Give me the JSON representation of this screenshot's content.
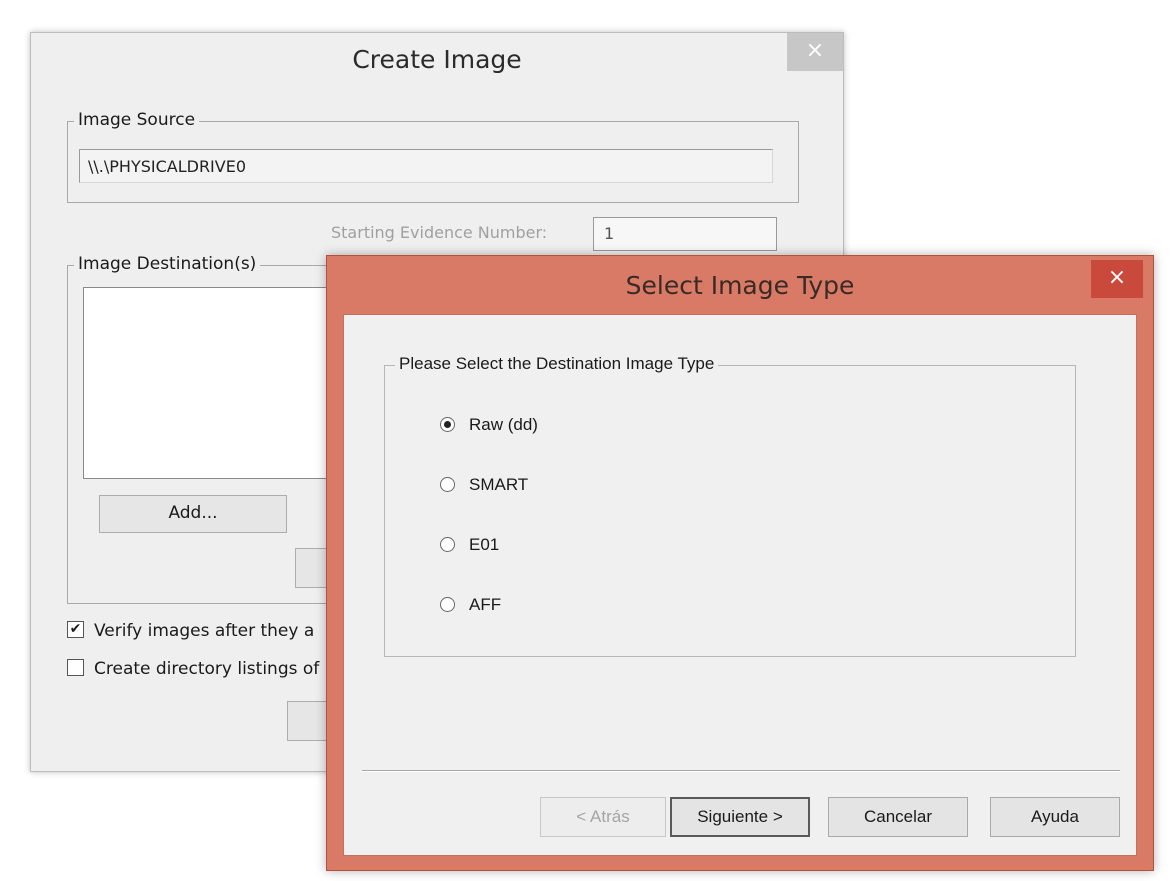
{
  "create_image": {
    "title": "Create Image",
    "close_glyph": "×",
    "image_source": {
      "label": "Image Source",
      "value": "\\\\.\\PHYSICALDRIVE0"
    },
    "starting_evidence_number": {
      "label": "Starting Evidence Number:",
      "value": "1"
    },
    "image_destinations": {
      "label": "Image Destination(s)",
      "add_button": "Add..."
    },
    "verify_checkbox": {
      "label": "Verify images after they a",
      "checked": true,
      "glyph": "✔"
    },
    "directory_checkbox": {
      "label": "Create directory listings of",
      "checked": false
    }
  },
  "select_image_type": {
    "title": "Select Image Type",
    "close_glyph": "×",
    "group_label": "Please Select the Destination Image Type",
    "options": [
      {
        "label": "Raw (dd)",
        "selected": true
      },
      {
        "label": "SMART",
        "selected": false
      },
      {
        "label": "E01",
        "selected": false
      },
      {
        "label": "AFF",
        "selected": false
      }
    ],
    "buttons": {
      "back": "< Atrás",
      "next": "Siguiente >",
      "cancel": "Cancelar",
      "help": "Ayuda"
    }
  },
  "colors": {
    "active_frame": "#d87a66",
    "close_active": "#c9493c",
    "inactive_frame": "#efefef"
  }
}
